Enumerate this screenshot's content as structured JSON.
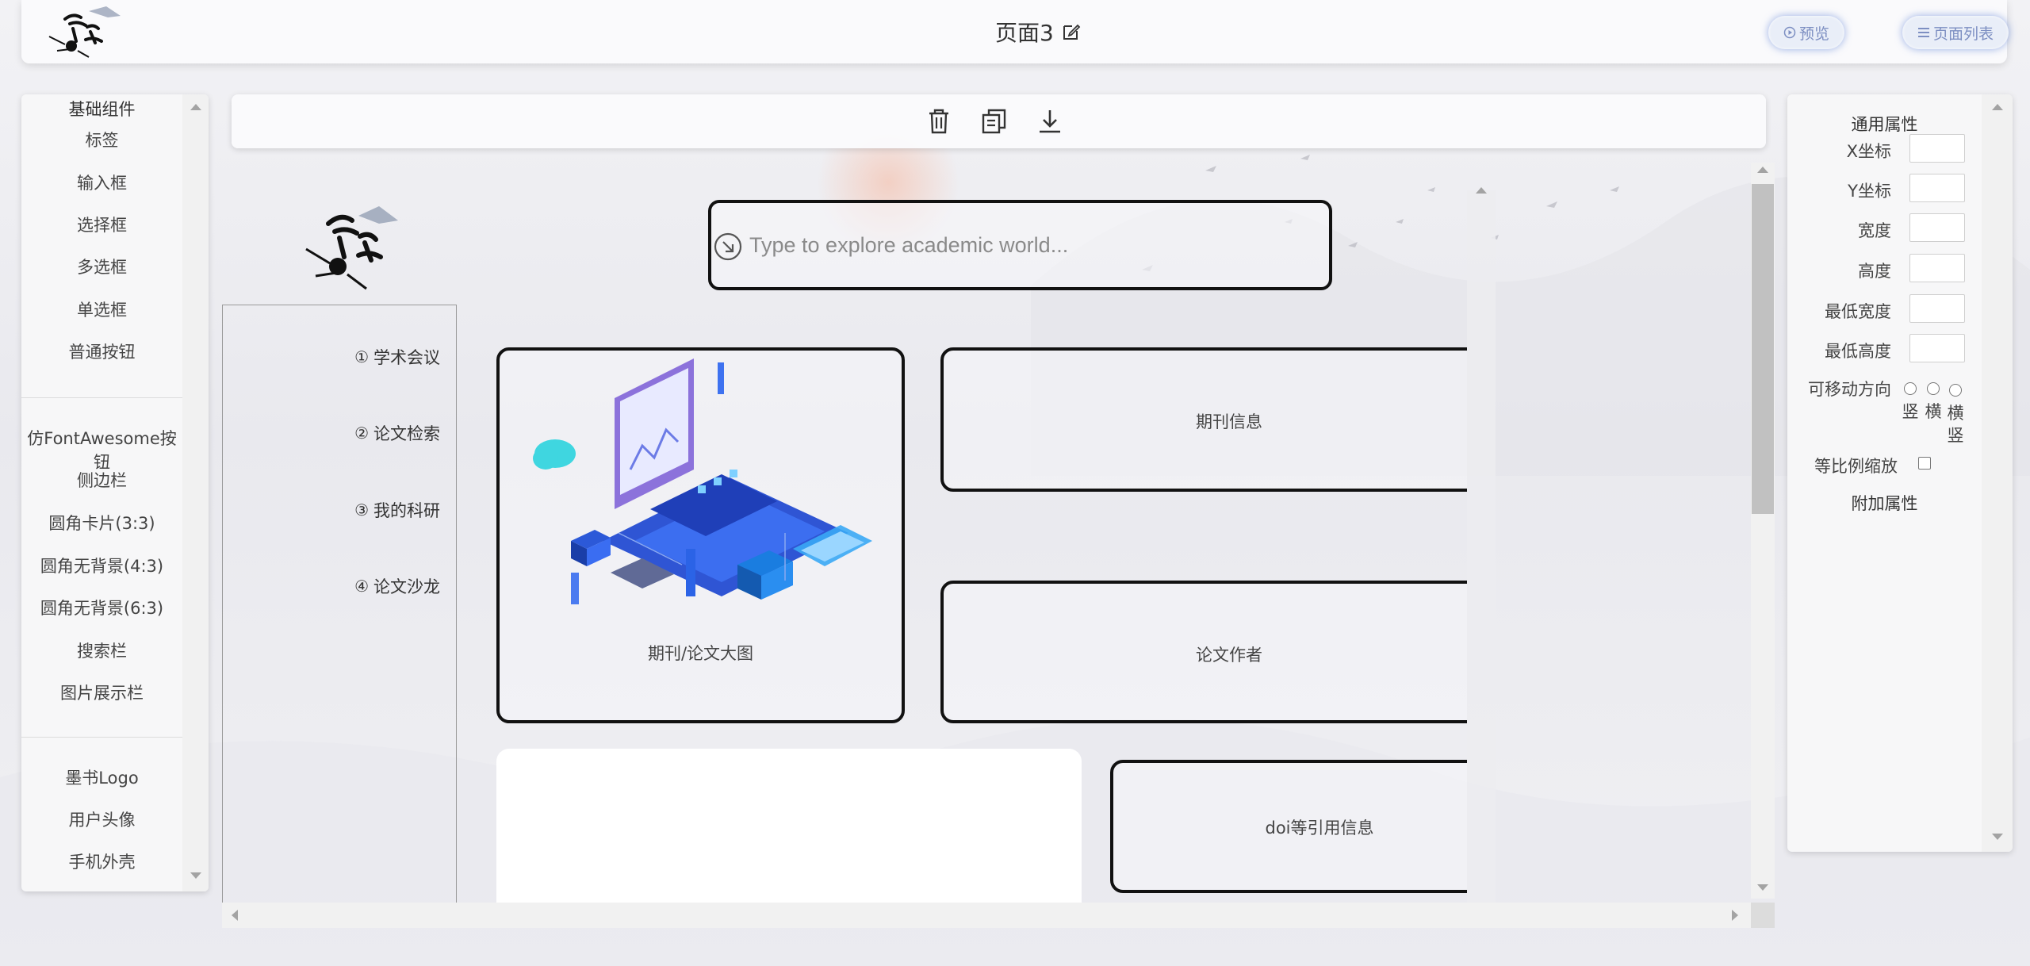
{
  "header": {
    "title": "页面3",
    "preview_label": "预览",
    "pagelist_label": "页面列表",
    "logo_text": "墨书"
  },
  "left_panel": {
    "section_title": "基础组件",
    "group1": [
      "标签",
      "输入框",
      "选择框",
      "多选框",
      "单选框",
      "普通按钮"
    ],
    "group2": [
      "仿FontAwesome按钮",
      "侧边栏",
      "圆角卡片(3:3)",
      "圆角无背景(4:3)",
      "圆角无背景(6:3)",
      "搜索栏",
      "图片展示栏"
    ],
    "group3": [
      "墨书Logo",
      "用户头像",
      "手机外壳"
    ]
  },
  "toolbar": {
    "icons": [
      "trash-icon",
      "copy-icon",
      "download-icon"
    ]
  },
  "canvas": {
    "logo_text": "墨书",
    "nav": [
      {
        "num": "①",
        "label": "学术会议"
      },
      {
        "num": "②",
        "label": "论文检索"
      },
      {
        "num": "③",
        "label": "我的科研"
      },
      {
        "num": "④",
        "label": "论文沙龙"
      }
    ],
    "search_placeholder": "Type to explore academic world...",
    "cards": {
      "big": "期刊/论文大图",
      "journal": "期刊信息",
      "author": "论文作者",
      "doi": "doi等引用信息"
    }
  },
  "right_panel": {
    "common_title": "通用属性",
    "props": [
      "X坐标",
      "Y坐标",
      "宽度",
      "高度",
      "最低宽度",
      "最低高度"
    ],
    "move_label": "可移动方向",
    "move_options": [
      "竖",
      "横",
      "横竖"
    ],
    "ratio_label": "等比例缩放",
    "extra_title": "附加属性"
  }
}
